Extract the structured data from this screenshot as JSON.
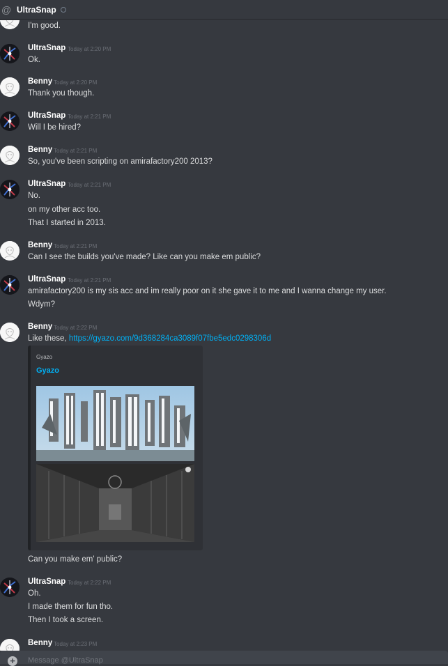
{
  "header": {
    "at_symbol": "@",
    "title": "UltraSnap"
  },
  "messages": [
    {
      "user": "",
      "time": "",
      "lines": [
        "I'm good."
      ]
    },
    {
      "user": "UltraSnap",
      "time": "Today at 2:20 PM",
      "lines": [
        "Ok."
      ]
    },
    {
      "user": "Benny",
      "time": "Today at 2:20 PM",
      "lines": [
        "Thank you though."
      ]
    },
    {
      "user": "UltraSnap",
      "time": "Today at 2:21 PM",
      "lines": [
        "Will I be hired?"
      ]
    },
    {
      "user": "Benny",
      "time": "Today at 2:21 PM",
      "lines": [
        "So, you've been scripting on amirafactory200 2013?"
      ]
    },
    {
      "user": "UltraSnap",
      "time": "Today at 2:21 PM",
      "lines": [
        "No.",
        "on my other acc too.",
        "That I started in 2013."
      ]
    },
    {
      "user": "Benny",
      "time": "Today at 2:21 PM",
      "lines": [
        "Can I see the builds you've made? Like can you make em public?"
      ]
    },
    {
      "user": "UltraSnap",
      "time": "Today at 2:21 PM",
      "lines": [
        "amirafactory200 is my sis acc and im really poor on it she gave it to me and I wanna change my user.",
        "Wdym?"
      ]
    },
    {
      "user": "Benny",
      "time": "Today at 2:22 PM",
      "lines": [
        "Like these, ",
        "Can you make em' public?"
      ],
      "link": "https://gyazo.com/9d368284ca3089f07fbe5edc0298306d"
    },
    {
      "user": "UltraSnap",
      "time": "Today at 2:22 PM",
      "lines": [
        "Oh.",
        "I made them for fun tho.",
        "Then I took a screen."
      ]
    },
    {
      "user": "Benny",
      "time": "Today at 2:23 PM",
      "lines": []
    }
  ],
  "embed": {
    "provider": "Gyazo",
    "title": "Gyazo"
  },
  "composer": {
    "placeholder": "Message @UltraSnap"
  },
  "colors": {
    "background": "#36393f",
    "link": "#00b0f4",
    "composer": "#40444b"
  }
}
